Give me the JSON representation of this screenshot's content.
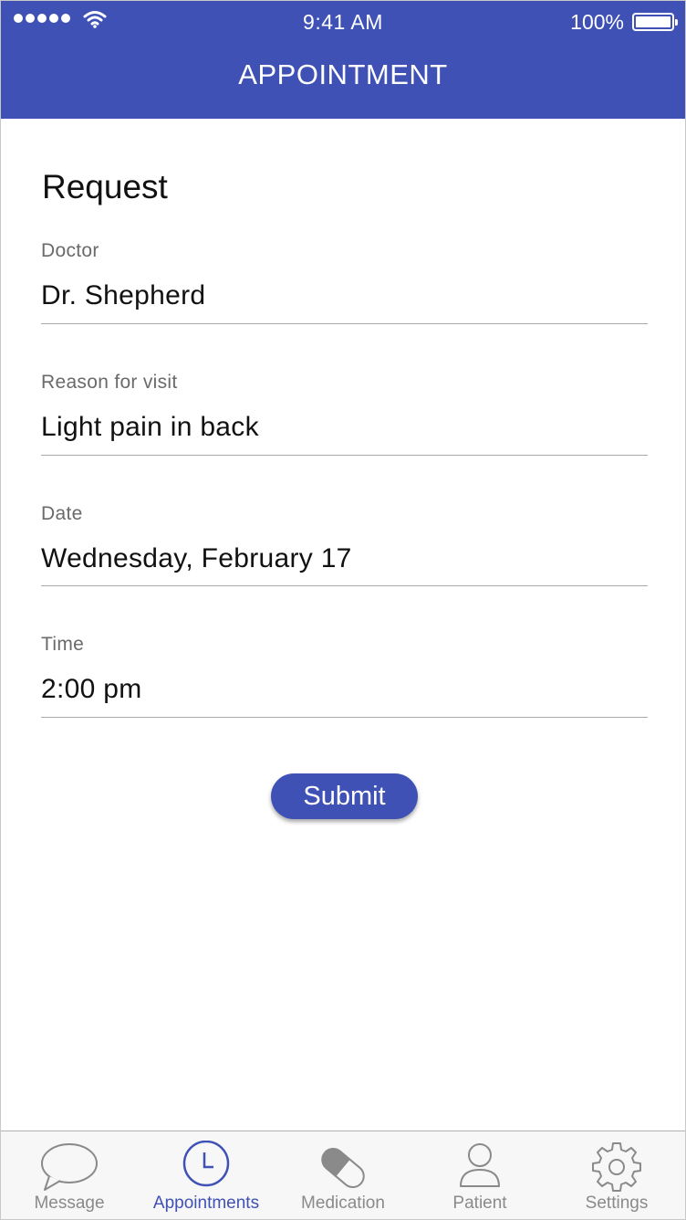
{
  "status_bar": {
    "time": "9:41 AM",
    "battery_percent": "100%",
    "battery_level": 1.0
  },
  "header": {
    "title": "APPOINTMENT",
    "background_color": "#3f51b5"
  },
  "form": {
    "heading": "Request",
    "fields": [
      {
        "label": "Doctor",
        "value": "Dr. Shepherd"
      },
      {
        "label": "Reason for visit",
        "value": "Light pain in back"
      },
      {
        "label": "Date",
        "value": "Wednesday, February 17"
      },
      {
        "label": "Time",
        "value": "2:00 pm"
      }
    ],
    "submit_label": "Submit"
  },
  "tabbar": {
    "active_color": "#3f51b5",
    "inactive_color": "#8a8a8a",
    "items": [
      {
        "label": "Message",
        "icon": "speech-bubble-icon",
        "active": false
      },
      {
        "label": "Appointments",
        "icon": "clock-icon",
        "active": true
      },
      {
        "label": "Medication",
        "icon": "pill-icon",
        "active": false
      },
      {
        "label": "Patient",
        "icon": "person-icon",
        "active": false
      },
      {
        "label": "Settings",
        "icon": "gear-icon",
        "active": false
      }
    ]
  }
}
